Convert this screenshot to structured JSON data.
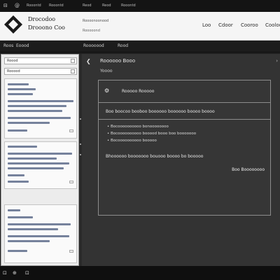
{
  "topbar": {
    "glyph1": "⊟",
    "glyph2": "@",
    "menu": [
      "Rooontd",
      "Rooontd",
      "Reod",
      "Reod",
      "Rooontd"
    ]
  },
  "header": {
    "brand_line1": "Drocodoo",
    "brand_line2": "Drooono Coo",
    "url_text": "Roooonoonood",
    "url_sub": "Rooooond",
    "nav": [
      "Loo",
      "Cdoor",
      "Cooroo",
      "Cooloo"
    ]
  },
  "toolbar": {
    "left": [
      "Roos",
      "Eoood"
    ],
    "center": [
      "Rooooood",
      "Rood"
    ]
  },
  "sidebar": {
    "search_value": "Roood",
    "filter_value": "Rooood"
  },
  "main": {
    "back_icon": "chevron-left",
    "title": "Roooooo  Booo",
    "subtitle": "Yoooo",
    "panel": {
      "title_icon": "tool-icon",
      "title": "Rooooo  Rooooo",
      "line1": "Boo  boocoo booboo  boooooo  boooooo  boooo  boooo",
      "bullets": [
        "• Bocoooooooooo  bonoooooooo",
        "• Bocoooooooooo  booood  booo  boo  booooooo",
        "• Bocoooooooooo  booooo"
      ],
      "ask": "Bhoooooo  booooooo  bouooo  boooo  bo  booooo",
      "action": "Boo  Boooooooo"
    }
  },
  "bottombar": {
    "b1": "⊡",
    "b2": "⊕",
    "b3": "⊡"
  },
  "colors": {
    "header_bg": "#f5f5f5",
    "main_bg": "#333333",
    "sidebar_bg": "#ececec",
    "topbar_bg": "#141414"
  }
}
